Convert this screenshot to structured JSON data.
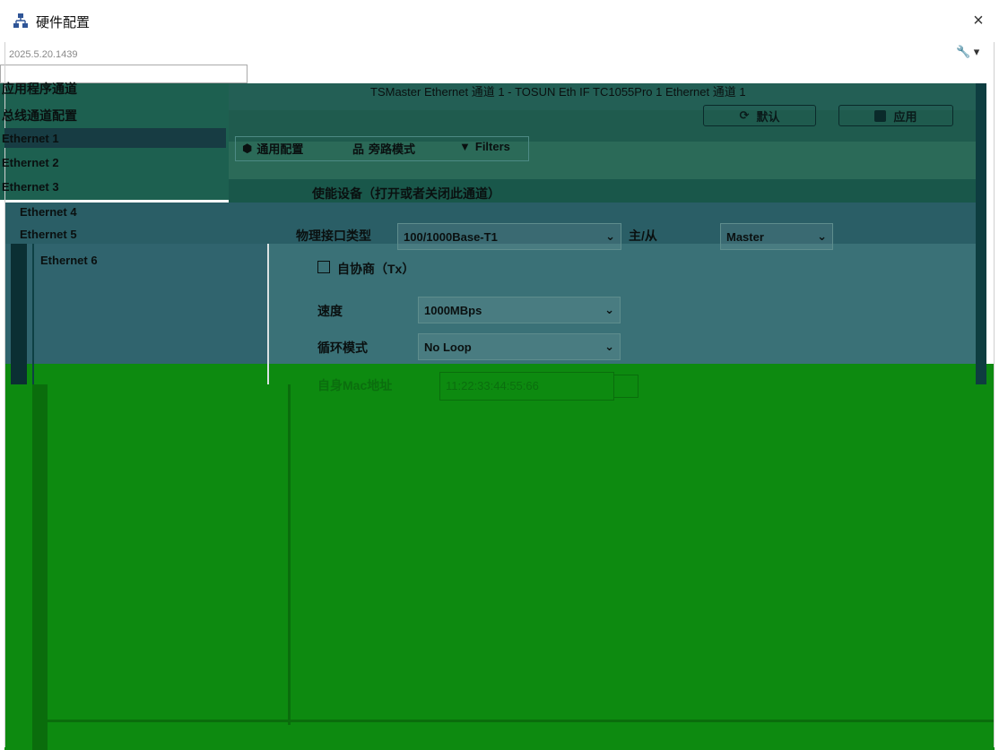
{
  "window": {
    "title": "硬件配置",
    "version": "2025.5.20.1439",
    "close_glyph": "×",
    "tool_glyph": "🔧 ▾"
  },
  "tree": {
    "header1": "应用程序通道",
    "header2": "总线通道配置",
    "items": [
      "Ethernet 1",
      "Ethernet 2",
      "Ethernet 3",
      "Ethernet 4",
      "Ethernet 5",
      "Ethernet 6"
    ],
    "selected_index": 0
  },
  "group": {
    "title": "TSMaster Ethernet 通道 1 - TOSUN Eth IF TC1055Pro 1 Ethernet 通道 1",
    "default_button": "默认",
    "apply_button": "应用"
  },
  "tabs": [
    "通用配置",
    "旁路模式",
    "Filters"
  ],
  "form": {
    "enable_label": "使能设备（打开或者关闭此通道）",
    "phy_label": "物理接口类型",
    "phy_value": "100/1000Base-T1",
    "role_label": "主/从",
    "role_value": "Master",
    "autoneg_label": "自协商（Tx）",
    "speed_label": "速度",
    "speed_value": "1000MBps",
    "loop_label": "循环模式",
    "loop_value": "No Loop",
    "mac_label": "自身Mac地址",
    "mac_value": "11:22:33:44:55:66"
  },
  "icons": {
    "app": "network-tree-icon",
    "close": "close-icon",
    "wrench": "wrench-icon",
    "refresh": "refresh-icon",
    "apply": "apply-icon",
    "general_tab": "cube-icon",
    "bypass_tab": "network-icon",
    "filter_tab": "filter-icon",
    "cursor": "cursor-icon"
  },
  "colors": {
    "glitch_green": "#0d8a10",
    "teal_band": "#1d6050",
    "accent": "#0b6e0e"
  }
}
